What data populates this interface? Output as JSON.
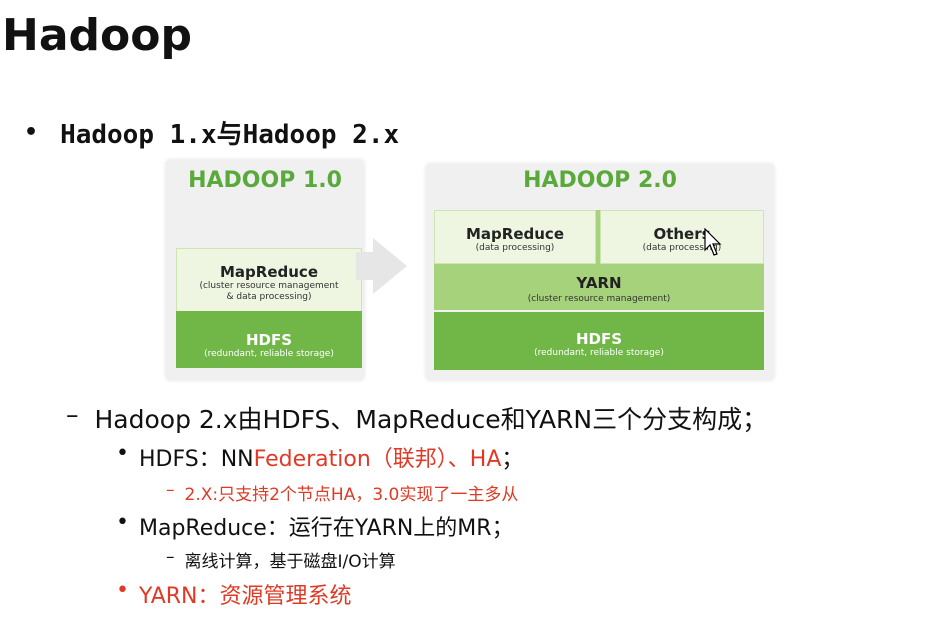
{
  "slide": {
    "title": "Hadoop",
    "main_bullet": "Hadoop 1.x与Hadoop 2.x"
  },
  "diagram": {
    "v1": {
      "title": "HADOOP 1.0",
      "mapreduce": {
        "name": "MapReduce",
        "desc1": "(cluster resource management",
        "desc2": "& data processing)"
      },
      "hdfs": {
        "name": "HDFS",
        "desc": "(redundant, reliable storage)"
      }
    },
    "v2": {
      "title": "HADOOP 2.0",
      "mapreduce": {
        "name": "MapReduce",
        "desc": "(data processing)"
      },
      "others": {
        "name": "Others",
        "desc": "(data processing)"
      },
      "yarn": {
        "name": "YARN",
        "desc": "(cluster resource management)"
      },
      "hdfs": {
        "name": "HDFS",
        "desc": "(redundant, reliable storage)"
      }
    },
    "colors": {
      "title_green": "#5aa93b",
      "light": "#eef6e2",
      "mid": "#a7d27c",
      "dark": "#71b748"
    }
  },
  "bullets": {
    "l1": "Hadoop 2.x由HDFS、MapReduce和YARN三个分支构成；",
    "hdfs": {
      "prefix": "HDFS：NN ",
      "red": "Federation（联邦）、HA",
      "suffix": "；",
      "sub": "2.X:只支持2个节点HA，3.0实现了一主多从"
    },
    "mapreduce": {
      "text": "MapReduce：运行在YARN上的MR；",
      "sub": "离线计算，基于磁盘I/O计算"
    },
    "yarn": {
      "text": "YARN：资源管理系统"
    },
    "accent_red": "#e03a26"
  }
}
